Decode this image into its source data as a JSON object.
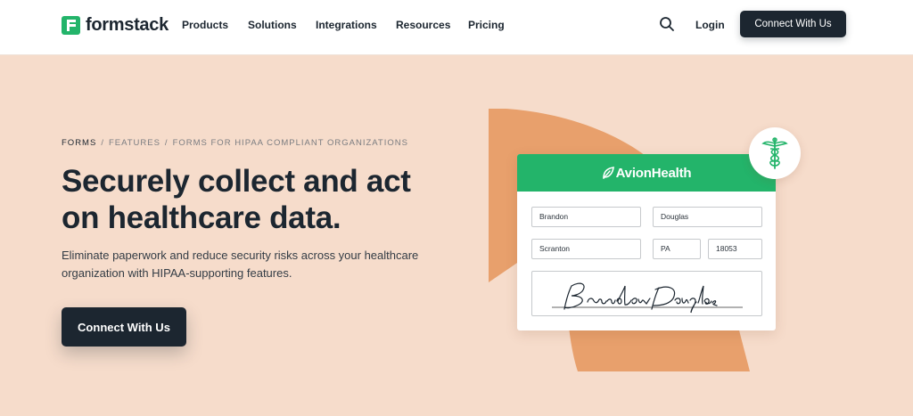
{
  "brand": {
    "name": "formstack"
  },
  "nav": {
    "items": [
      "Products",
      "Solutions",
      "Integrations",
      "Resources",
      "Pricing"
    ],
    "login": "Login",
    "cta": "Connect With Us"
  },
  "breadcrumb": {
    "items": [
      "FORMS",
      "FEATURES",
      "FORMS FOR HIPAA COMPLIANT ORGANIZATIONS"
    ],
    "separator": "/"
  },
  "hero": {
    "title": "Securely collect and act on healthcare data.",
    "description": "Eliminate paperwork and reduce security risks across your healthcare organization with HIPAA-supporting features.",
    "cta": "Connect With Us"
  },
  "illustration": {
    "brand": "AvionHealth",
    "fields": {
      "first_name": "Brandon",
      "last_name": "Douglas",
      "city": "Scranton",
      "state": "PA",
      "zip": "18053"
    },
    "signature_icon": "handwritten-signature",
    "badge_icon": "caduceus-icon"
  },
  "colors": {
    "background": "#f6dccb",
    "dark": "#1c2630",
    "green": "#23b46a",
    "accent_orange": "#e8a06c"
  }
}
